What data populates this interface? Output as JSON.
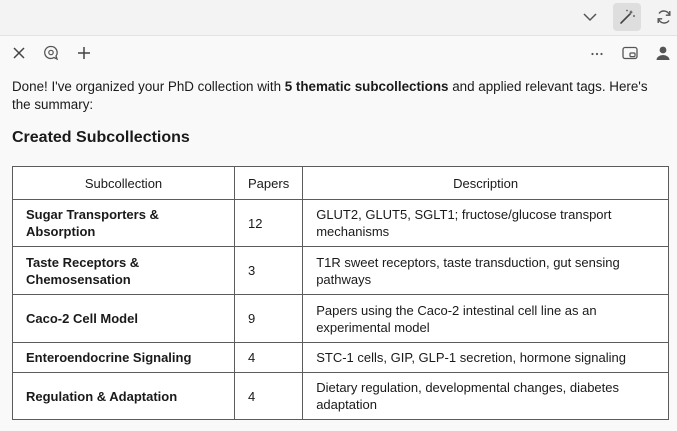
{
  "topbar": {
    "icons": [
      "chevron-down-icon",
      "magic-wand-icon",
      "refresh-icon"
    ]
  },
  "toolbar": {
    "left_icons": [
      "close-icon",
      "chat-search-icon",
      "plus-icon"
    ],
    "right_icons": [
      "more-icon",
      "picture-in-picture-icon",
      "user-icon"
    ]
  },
  "message": {
    "intro_prefix": "Done! I've organized your PhD collection with ",
    "intro_bold": "5 thematic subcollections",
    "intro_suffix": " and applied relevant tags. Here's the summary:",
    "heading": "Created Subcollections"
  },
  "table": {
    "headers": {
      "subcollection": "Subcollection",
      "papers": "Papers",
      "description": "Description"
    },
    "rows": [
      {
        "name": "Sugar Transporters & Absorption",
        "papers": "12",
        "description": "GLUT2, GLUT5, SGLT1; fructose/glucose transport mechanisms"
      },
      {
        "name": "Taste Receptors & Chemosensation",
        "papers": "3",
        "description": "T1R sweet receptors, taste transduction, gut sensing pathways"
      },
      {
        "name": "Caco-2 Cell Model",
        "papers": "9",
        "description": "Papers using the Caco-2 intestinal cell line as an experimental model"
      },
      {
        "name": "Enteroendocrine Signaling",
        "papers": "4",
        "description": "STC-1 cells, GIP, GLP-1 secretion, hormone signaling"
      },
      {
        "name": "Regulation & Adaptation",
        "papers": "4",
        "description": "Dietary regulation, developmental changes, diabetes adaptation"
      }
    ]
  }
}
